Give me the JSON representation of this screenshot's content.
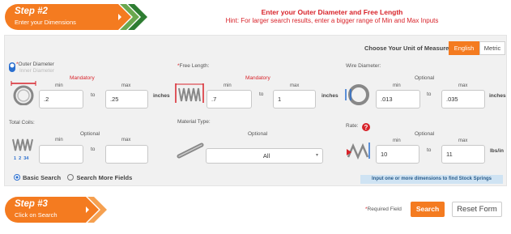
{
  "step2": {
    "title": "Step #2",
    "subtitle": "Enter your Dimensions"
  },
  "step3": {
    "title": "Step #3",
    "subtitle": "Click on Search"
  },
  "header": {
    "title": "Enter your Outer Diameter and Free Length",
    "hint": "Hint: For larger search results, enter a bigger range of Min and Max Inputs"
  },
  "units": {
    "label": "Choose Your Unit of Measure:",
    "english": "English",
    "metric": "Metric",
    "selected": "English"
  },
  "diameter": {
    "outer_label": "Outer Diameter",
    "inner_label": "Inner Diameter",
    "status": "Mandatory",
    "min_label": "min",
    "max_label": "max",
    "to": "to",
    "min": ".2",
    "max": ".25",
    "unit": "inches"
  },
  "free_length": {
    "label": "Free Length:",
    "status": "Mandatory",
    "min_label": "min",
    "max_label": "max",
    "to": "to",
    "min": ".7",
    "max": "1",
    "unit": "inches"
  },
  "wire_diameter": {
    "label": "Wire Diameter:",
    "status": "Optional",
    "min_label": "min",
    "max_label": "max",
    "to": "to",
    "min": ".013",
    "max": ".035",
    "unit": "inches"
  },
  "total_coils": {
    "label": "Total Coils:",
    "status": "Optional",
    "min_label": "min",
    "max_label": "max",
    "to": "to",
    "min": "",
    "max": "",
    "icon_labels": [
      "1",
      "2",
      "34"
    ]
  },
  "material": {
    "label": "Material Type:",
    "status": "Optional",
    "selected": "All"
  },
  "rate": {
    "label": "Rate:",
    "status": "Optional",
    "min_label": "min",
    "max_label": "max",
    "to": "to",
    "min": "10",
    "max": "11",
    "unit": "lbs/in"
  },
  "search_mode": {
    "basic": "Basic Search",
    "more": "Search More Fields",
    "selected": "Basic Search"
  },
  "info": "Input one or more dimensions to find Stock Springs",
  "footer": {
    "required_note": "Required Field",
    "search": "Search",
    "reset": "Reset Form"
  },
  "colors": {
    "accent": "#f47b20",
    "required": "#d8232a",
    "info_bg": "#cfe3f3",
    "radio": "#2b6fcf"
  }
}
